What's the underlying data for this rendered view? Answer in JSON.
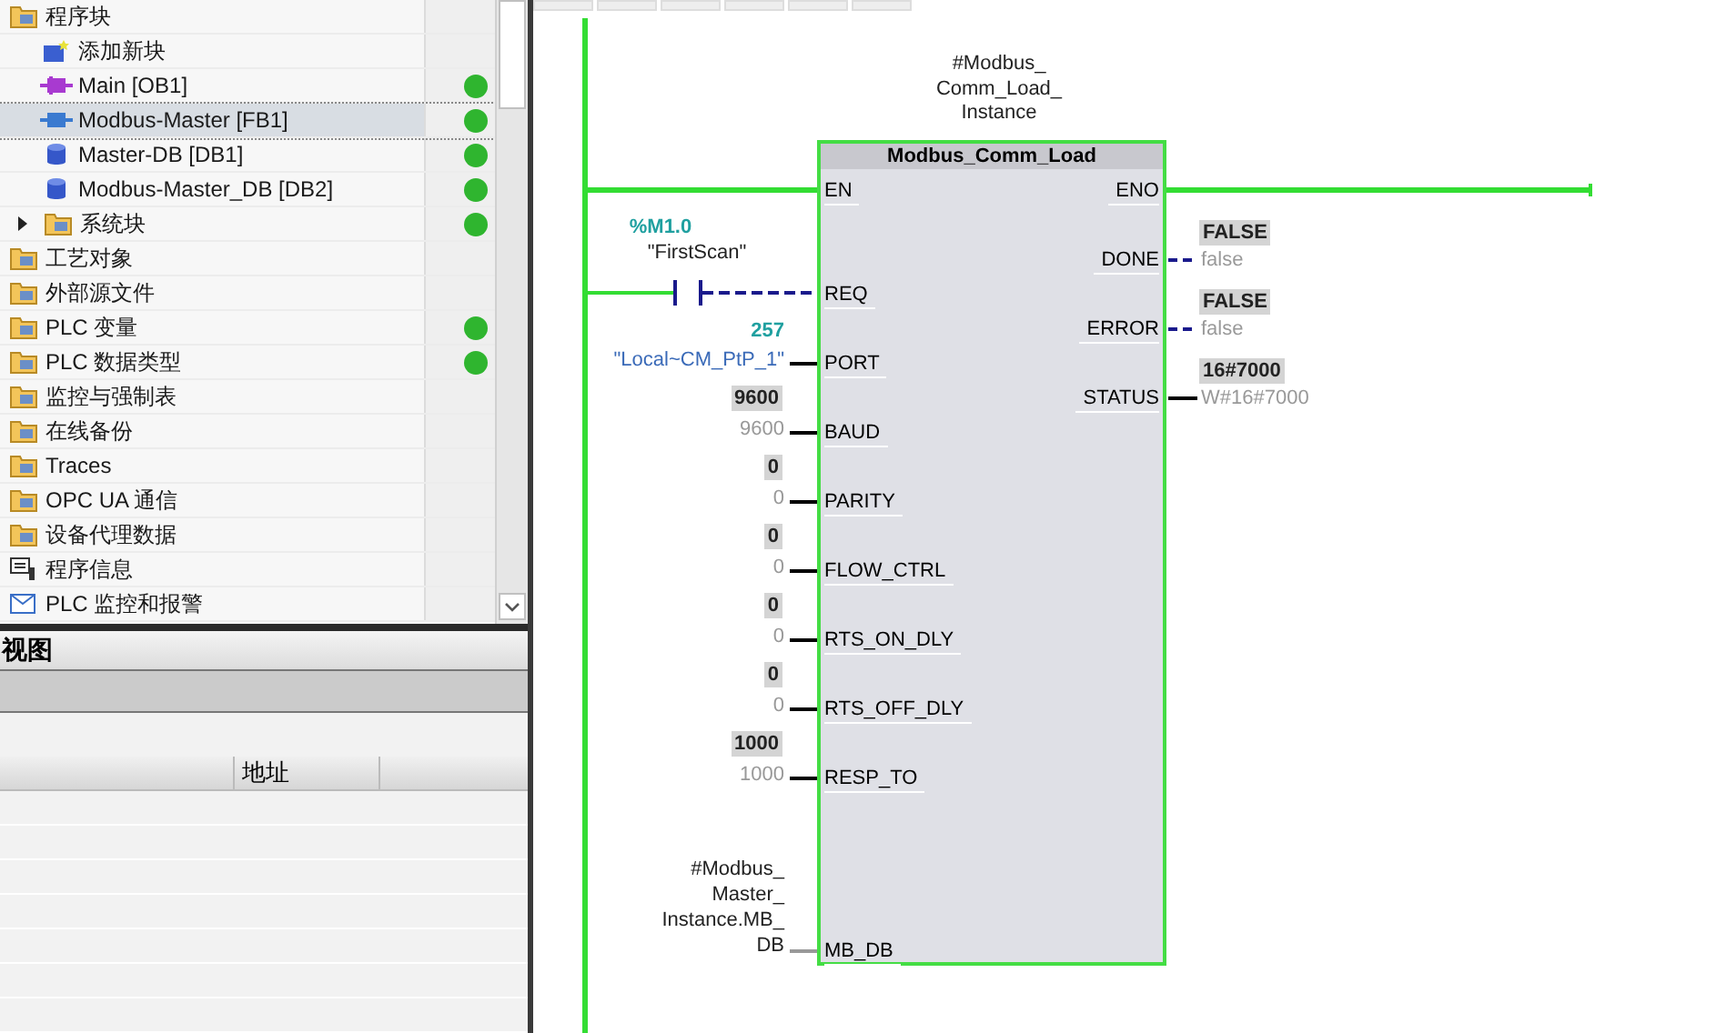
{
  "project_tree": {
    "items": [
      {
        "label": "程序块",
        "kind": "folder",
        "status": false,
        "selected": false,
        "children": [
          {
            "label": "添加新块",
            "kind": "add",
            "status": false,
            "selected": false
          },
          {
            "label": "Main [OB1]",
            "kind": "ob",
            "status": true,
            "selected": false
          },
          {
            "label": "Modbus-Master [FB1]",
            "kind": "fb",
            "status": true,
            "selected": true
          },
          {
            "label": "Master-DB [DB1]",
            "kind": "db",
            "status": true,
            "selected": false
          },
          {
            "label": "Modbus-Master_DB [DB2]",
            "kind": "db",
            "status": true,
            "selected": false
          },
          {
            "label": "系统块",
            "kind": "folder",
            "status": true,
            "selected": false,
            "expanded": false
          }
        ]
      },
      {
        "label": "工艺对象",
        "kind": "folder",
        "status": false,
        "selected": false
      },
      {
        "label": "外部源文件",
        "kind": "folder",
        "status": false,
        "selected": false
      },
      {
        "label": "PLC 变量",
        "kind": "folder",
        "status": true,
        "selected": false
      },
      {
        "label": "PLC 数据类型",
        "kind": "folder",
        "status": true,
        "selected": false
      },
      {
        "label": "监控与强制表",
        "kind": "folder",
        "status": false,
        "selected": false
      },
      {
        "label": "在线备份",
        "kind": "folder",
        "status": false,
        "selected": false
      },
      {
        "label": "Traces",
        "kind": "folder",
        "status": false,
        "selected": false
      },
      {
        "label": "OPC UA 通信",
        "kind": "folder",
        "status": false,
        "selected": false
      },
      {
        "label": "设备代理数据",
        "kind": "folder",
        "status": false,
        "selected": false
      },
      {
        "label": "程序信息",
        "kind": "info",
        "status": false,
        "selected": false
      },
      {
        "label": "PLC 监控和报警",
        "kind": "alarm",
        "status": false,
        "selected": false
      }
    ]
  },
  "detail_view": {
    "title": "视图",
    "columns": [
      "地址"
    ]
  },
  "network": {
    "instance": [
      "#Modbus_",
      "Comm_Load_",
      "Instance"
    ],
    "block": "Modbus_Comm_Load",
    "inputs": [
      {
        "pin": "EN",
        "kind": "rail"
      },
      {
        "pin": "REQ",
        "kind": "contact",
        "address": "%M1.0",
        "tag": "\"FirstScan\"",
        "energized": false
      },
      {
        "pin": "PORT",
        "kind": "tag",
        "value": "257",
        "operand": "\"Local~CM_PtP_1\""
      },
      {
        "pin": "BAUD",
        "kind": "constant",
        "value": "9600",
        "operand": "9600"
      },
      {
        "pin": "PARITY",
        "kind": "constant",
        "value": "0",
        "operand": "0"
      },
      {
        "pin": "FLOW_CTRL",
        "kind": "constant",
        "value": "0",
        "operand": "0"
      },
      {
        "pin": "RTS_ON_DLY",
        "kind": "constant",
        "value": "0",
        "operand": "0"
      },
      {
        "pin": "RTS_OFF_DLY",
        "kind": "constant",
        "value": "0",
        "operand": "0"
      },
      {
        "pin": "RESP_TO",
        "kind": "constant",
        "value": "1000",
        "operand": "1000"
      },
      {
        "pin": "MB_DB",
        "kind": "instance",
        "operand": [
          "#Modbus_",
          "Master_",
          "Instance.MB_",
          "DB"
        ]
      }
    ],
    "outputs": [
      {
        "pin": "ENO",
        "kind": "rail"
      },
      {
        "pin": "DONE",
        "kind": "bool",
        "value": "FALSE",
        "operand": "false",
        "energized": false
      },
      {
        "pin": "ERROR",
        "kind": "bool",
        "value": "FALSE",
        "operand": "false",
        "energized": false
      },
      {
        "pin": "STATUS",
        "kind": "word",
        "value": "16#7000",
        "operand": "W#16#7000"
      }
    ]
  }
}
